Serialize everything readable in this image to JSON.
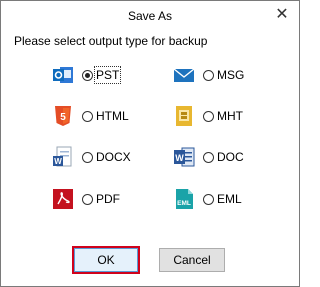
{
  "dialog": {
    "title": "Save As",
    "close_glyph": "✕",
    "prompt": "Please select output type for backup"
  },
  "options": [
    {
      "label": "PST",
      "icon": "outlook-icon",
      "checked": true
    },
    {
      "label": "MSG",
      "icon": "envelope-icon",
      "checked": false
    },
    {
      "label": "HTML",
      "icon": "html5-icon",
      "checked": false
    },
    {
      "label": "MHT",
      "icon": "mht-file-icon",
      "checked": false
    },
    {
      "label": "DOCX",
      "icon": "word-docx-icon",
      "checked": false
    },
    {
      "label": "DOC",
      "icon": "word-doc-icon",
      "checked": false
    },
    {
      "label": "PDF",
      "icon": "pdf-icon",
      "checked": false
    },
    {
      "label": "EML",
      "icon": "eml-file-icon",
      "checked": false
    }
  ],
  "buttons": {
    "ok": "OK",
    "cancel": "Cancel"
  },
  "colors": {
    "highlight": "#d0021b",
    "outlook": "#0f6cbd",
    "html5": "#e44d26",
    "word": "#2b579a",
    "pdf": "#c4121f",
    "eml": "#1aa3a8",
    "mht": "#e8b730"
  }
}
